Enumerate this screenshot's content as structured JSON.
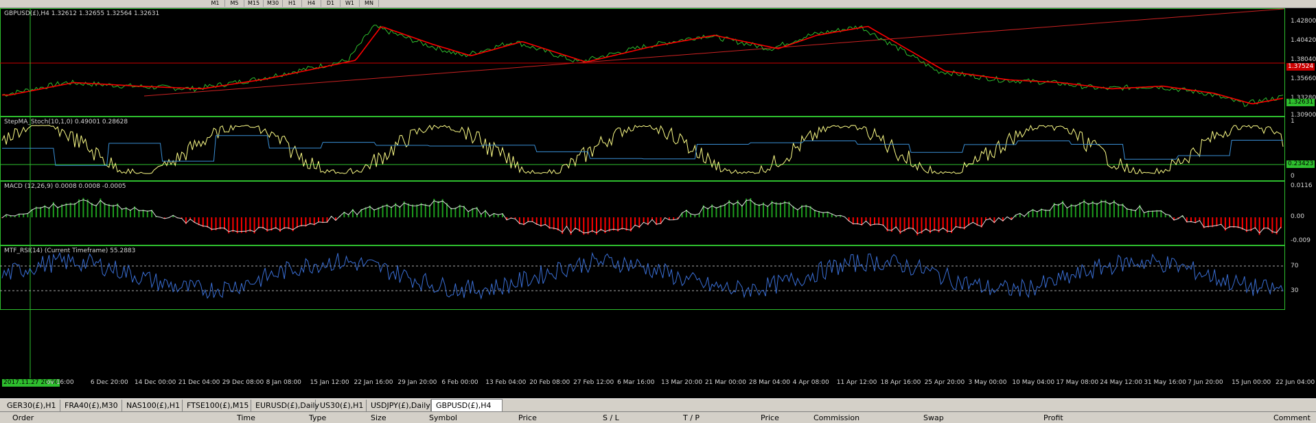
{
  "toolbar": {
    "timeframes": [
      "M1",
      "M5",
      "M15",
      "M30",
      "H1",
      "H4",
      "D1",
      "W1",
      "MN"
    ]
  },
  "panes": {
    "price": {
      "label": "GBPUSD(£),H4  1.32612 1.32655 1.32564 1.32631",
      "axis": [
        "1.42800",
        "1.40420",
        "1.38040",
        "1.35660",
        "1.33280",
        "1.30900"
      ],
      "hline_badge": "1.37524",
      "current_badge": "1.32631",
      "current_color": "#2ebf2e",
      "hline_color": "#cc0000"
    },
    "stoch": {
      "label": "StepMA_Stoch(10,1,0) 0.49001 0.28628",
      "axis": [
        "1",
        "0.23423",
        "0"
      ]
    },
    "macd": {
      "label": "MACD (12,26,9) 0.0008 0.0008 -0.0005",
      "axis": [
        "0.0116",
        "0.00",
        "-0.009"
      ]
    },
    "rsi": {
      "label": "MTF_RSI(14) (Current Timeframe) 55.2883",
      "axis": [
        "70",
        "30"
      ]
    }
  },
  "time_axis": {
    "badge": "2017.11.27 20:00",
    "labels": [
      "ov 16:00",
      "6 Dec 20:00",
      "14 Dec 00:00",
      "21 Dec 04:00",
      "29 Dec 08:00",
      "8 Jan 08:00",
      "15 Jan 12:00",
      "22 Jan 16:00",
      "29 Jan 20:00",
      "6 Feb 00:00",
      "13 Feb 04:00",
      "20 Feb 08:00",
      "27 Feb 12:00",
      "6 Mar 16:00",
      "13 Mar 20:00",
      "21 Mar 00:00",
      "28 Mar 04:00",
      "4 Apr 08:00",
      "11 Apr 12:00",
      "18 Apr 16:00",
      "25 Apr 20:00",
      "3 May 00:00",
      "10 May 04:00",
      "17 May 08:00",
      "24 May 12:00",
      "31 May 16:00",
      "7 Jun 20:00",
      "15 Jun 00:00",
      "22 Jun 04:00"
    ]
  },
  "tabs": [
    {
      "label": "GER30(£),H1"
    },
    {
      "label": "FRA40(£),M30"
    },
    {
      "label": "NAS100(£),H1"
    },
    {
      "label": "FTSE100(£),M15"
    },
    {
      "label": "EURUSD(£),Daily"
    },
    {
      "label": "US30(£),H1"
    },
    {
      "label": "USDJPY(£),Daily"
    },
    {
      "label": "GBPUSD(£),H4",
      "active": true
    }
  ],
  "terminal_columns": [
    "Order",
    "Time",
    "Type",
    "Size",
    "Symbol",
    "Price",
    "S / L",
    "T / P",
    "Price",
    "Commission",
    "Swap",
    "Profit",
    "Comment"
  ],
  "colors": {
    "grid_border": "#2ebf2e",
    "price_line": "#2ebf2e",
    "ma": "#ff0000",
    "stoch_main": "#ffff88",
    "stoch_signal": "#3a8fd6",
    "macd_pos": "#1e9e1e",
    "macd_neg": "#ff0000",
    "rsi": "#3a6fd6"
  }
}
